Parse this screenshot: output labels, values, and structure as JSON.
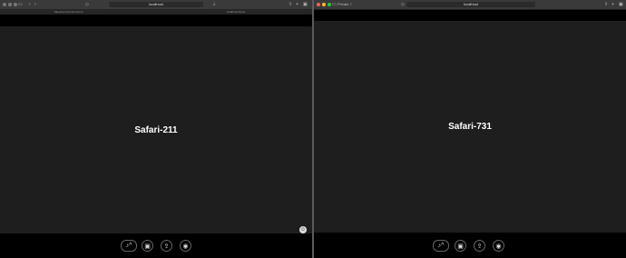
{
  "left_window": {
    "url": "localhost",
    "tab_left": "Meeting Controls Demo",
    "tab_right": "localhost demo",
    "participant_label": "Safari-211"
  },
  "right_window": {
    "sidebar_label": "Private",
    "url": "localhost",
    "participant_label": "Safari-731"
  },
  "controls": {
    "mic_caret": "^"
  },
  "colors": {
    "stage_bg": "#1e1e1e",
    "chrome_bg": "#3a3a3a",
    "traffic_red": "#ff5f57",
    "traffic_yellow": "#febc2e",
    "traffic_green": "#28c840"
  }
}
